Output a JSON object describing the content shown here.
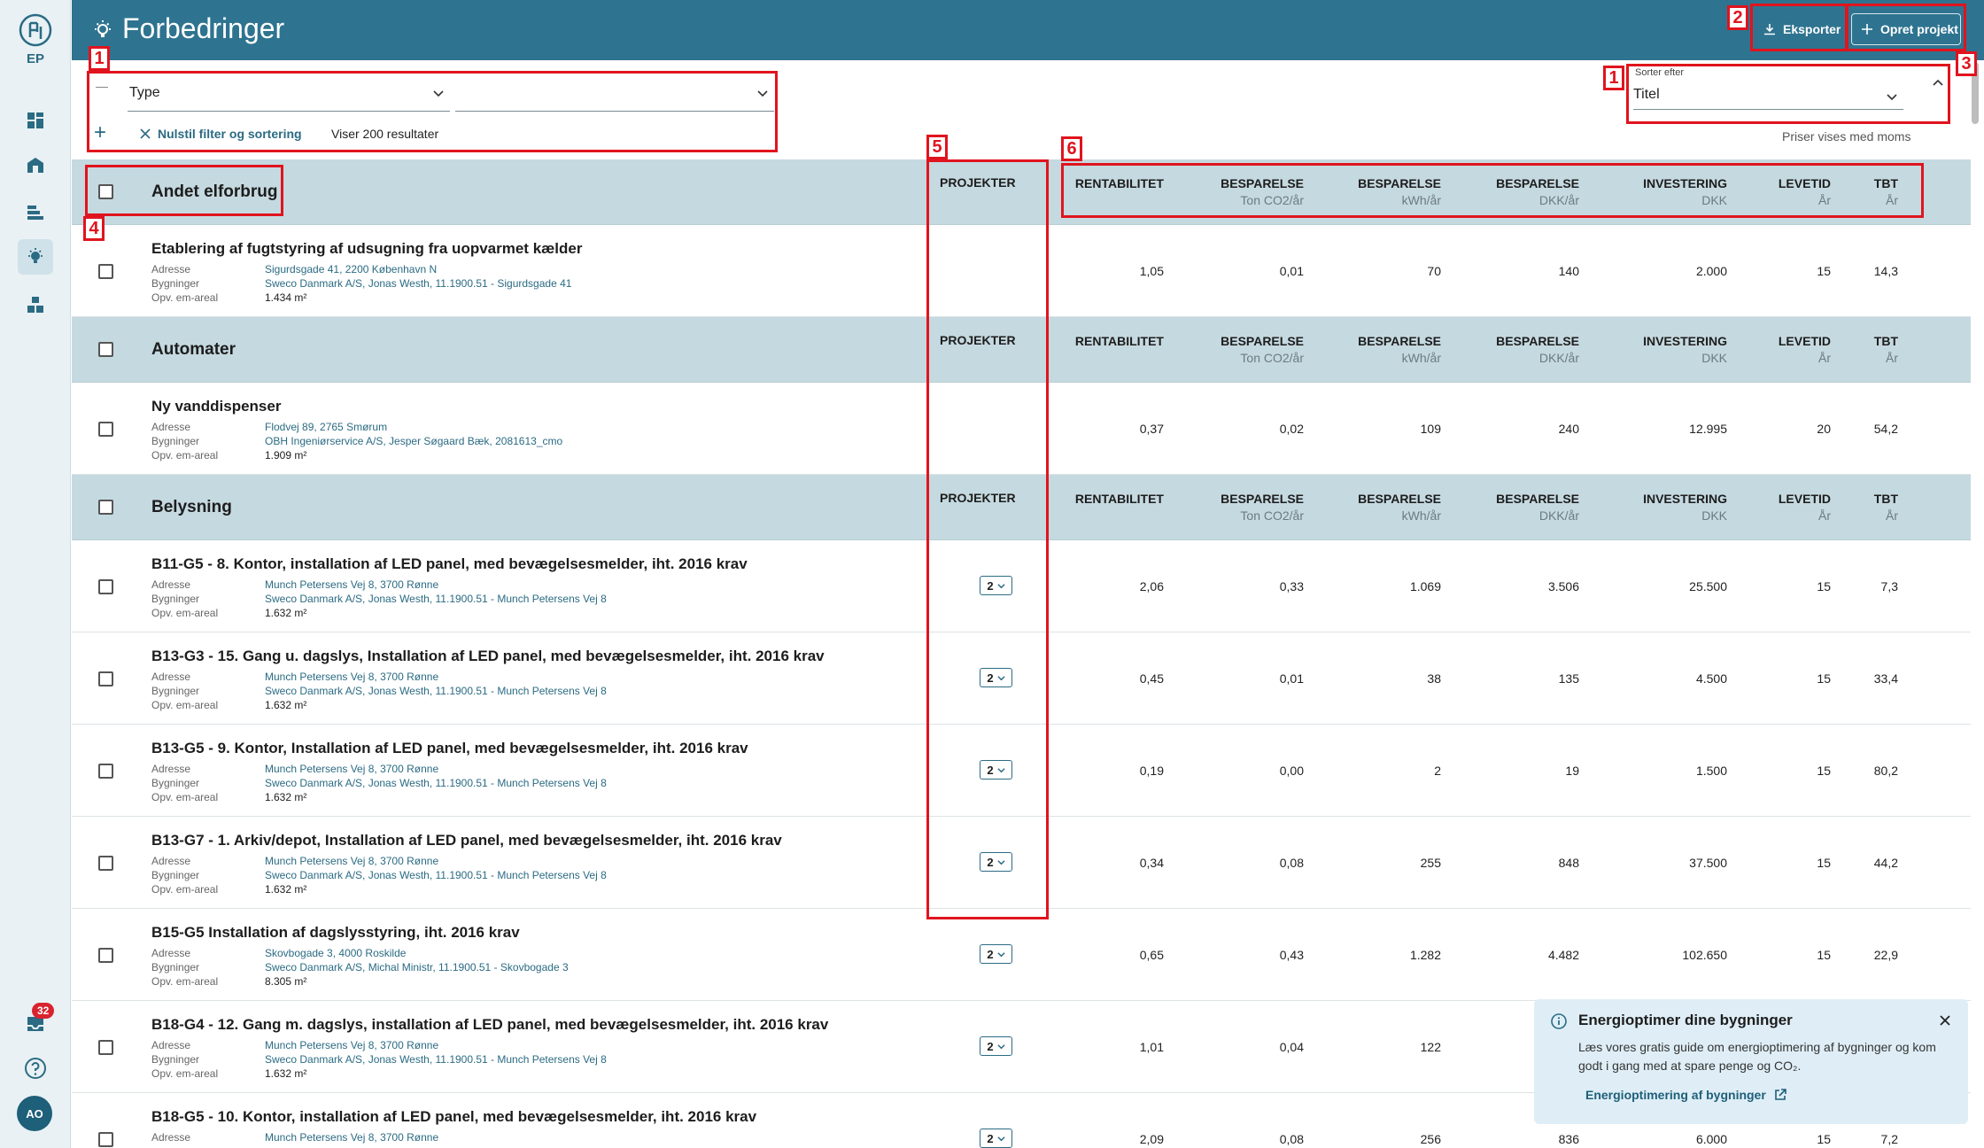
{
  "app": {
    "logo_text": "EP",
    "page_title": "Forbedringer"
  },
  "header": {
    "export_label": "Eksporter",
    "create_label": "Opret projekt"
  },
  "filters": {
    "type_label": "Type",
    "second_value": "",
    "reset_label": "Nulstil filter og sortering",
    "results_text": "Viser 200 resultater"
  },
  "sort": {
    "label": "Sorter efter",
    "value": "Titel"
  },
  "vat_note": "Priser vises med moms",
  "columns": {
    "projects": "PROJEKTER",
    "rentability": "RENTABILITET",
    "saving": "BESPARELSE",
    "co2_unit": "Ton CO2/år",
    "kwh_unit": "kWh/år",
    "dkk_unit": "DKK/år",
    "investment": "INVESTERING",
    "investment_unit": "DKK",
    "lifetime": "LEVETID",
    "lifetime_unit": "År",
    "tbt": "TBT",
    "tbt_unit": "År"
  },
  "labels": {
    "address": "Adresse",
    "buildings": "Bygninger",
    "area": "Opv. em-areal"
  },
  "groups": [
    {
      "title": "Andet elforbrug",
      "rows": [
        {
          "title": "Etablering af fugtstyring af udsugning fra uopvarmet kælder",
          "address": "Sigurdsgade 41, 2200 København N",
          "building": "Sweco Danmark A/S, Jonas Westh, 11.1900.51 - Sigurdsgade 41",
          "area": "1.434 m²",
          "projects": "",
          "rent": "1,05",
          "co2": "0,01",
          "kwh": "70",
          "dkk": "140",
          "inv": "2.000",
          "life": "15",
          "tbt": "14,3"
        }
      ]
    },
    {
      "title": "Automater",
      "rows": [
        {
          "title": "Ny vanddispenser",
          "address": "Flodvej 89, 2765 Smørum",
          "building": "OBH Ingeniørservice A/S, Jesper Søgaard Bæk, 2081613_cmo",
          "area": "1.909 m²",
          "projects": "",
          "rent": "0,37",
          "co2": "0,02",
          "kwh": "109",
          "dkk": "240",
          "inv": "12.995",
          "life": "20",
          "tbt": "54,2"
        }
      ]
    },
    {
      "title": "Belysning",
      "rows": [
        {
          "title": "B11-G5 - 8. Kontor, installation af LED panel, med bevægelsesmelder, iht. 2016 krav",
          "address": "Munch Petersens Vej 8, 3700 Rønne",
          "building": "Sweco Danmark A/S, Jonas Westh, 11.1900.51 - Munch Petersens Vej 8",
          "area": "1.632 m²",
          "projects": "2",
          "rent": "2,06",
          "co2": "0,33",
          "kwh": "1.069",
          "dkk": "3.506",
          "inv": "25.500",
          "life": "15",
          "tbt": "7,3"
        },
        {
          "title": "B13-G3 - 15. Gang u. dagslys, Installation af LED panel, med bevægelsesmelder, iht. 2016 krav",
          "address": "Munch Petersens Vej 8, 3700 Rønne",
          "building": "Sweco Danmark A/S, Jonas Westh, 11.1900.51 - Munch Petersens Vej 8",
          "area": "1.632 m²",
          "projects": "2",
          "rent": "0,45",
          "co2": "0,01",
          "kwh": "38",
          "dkk": "135",
          "inv": "4.500",
          "life": "15",
          "tbt": "33,4"
        },
        {
          "title": "B13-G5 - 9. Kontor, Installation af LED panel, med bevægelsesmelder, iht. 2016 krav",
          "address": "Munch Petersens Vej 8, 3700 Rønne",
          "building": "Sweco Danmark A/S, Jonas Westh, 11.1900.51 - Munch Petersens Vej 8",
          "area": "1.632 m²",
          "projects": "2",
          "rent": "0,19",
          "co2": "0,00",
          "kwh": "2",
          "dkk": "19",
          "inv": "1.500",
          "life": "15",
          "tbt": "80,2"
        },
        {
          "title": "B13-G7 - 1. Arkiv/depot, Installation af LED panel, med bevægelsesmelder, iht. 2016 krav",
          "address": "Munch Petersens Vej 8, 3700 Rønne",
          "building": "Sweco Danmark A/S, Jonas Westh, 11.1900.51 - Munch Petersens Vej 8",
          "area": "1.632 m²",
          "projects": "2",
          "rent": "0,34",
          "co2": "0,08",
          "kwh": "255",
          "dkk": "848",
          "inv": "37.500",
          "life": "15",
          "tbt": "44,2"
        },
        {
          "title": "B15-G5 Installation af dagslysstyring, iht. 2016 krav",
          "address": "Skovbogade 3, 4000 Roskilde",
          "building": "Sweco Danmark A/S, Michal Ministr, 11.1900.51 - Skovbogade 3",
          "area": "8.305 m²",
          "projects": "2",
          "rent": "0,65",
          "co2": "0,43",
          "kwh": "1.282",
          "dkk": "4.482",
          "inv": "102.650",
          "life": "15",
          "tbt": "22,9"
        },
        {
          "title": "B18-G4 - 12. Gang m. dagslys, installation af LED panel, med bevægelsesmelder, iht. 2016 krav",
          "address": "Munch Petersens Vej 8, 3700 Rønne",
          "building": "Sweco Danmark A/S, Jonas Westh, 11.1900.51 - Munch Petersens Vej 8",
          "area": "1.632 m²",
          "projects": "2",
          "rent": "1,01",
          "co2": "0,04",
          "kwh": "122",
          "dkk": "",
          "inv": "",
          "life": "",
          "tbt": ""
        },
        {
          "title": "B18-G5 - 10. Kontor, installation af LED panel, med bevægelsesmelder, iht. 2016 krav",
          "address": "Munch Petersens Vej 8, 3700 Rønne",
          "building": "",
          "area": "",
          "projects": "2",
          "rent": "2,09",
          "co2": "0,08",
          "kwh": "256",
          "dkk": "836",
          "inv": "6.000",
          "life": "15",
          "tbt": "7,2"
        }
      ]
    }
  ],
  "inbox_count": "32",
  "user_initials": "AO",
  "toast": {
    "title": "Energioptimer dine bygninger",
    "body": "Læs vores gratis guide om energioptimering af bygninger og kom godt i gang med at spare penge og CO₂.",
    "link": "Energioptimering af bygninger"
  },
  "annotations": [
    "1",
    "2",
    "3",
    "1",
    "4",
    "5",
    "6"
  ],
  "colors": {
    "brand": "#2e7490",
    "group_bg": "#c5d9e0",
    "link": "#2b6b83",
    "annotation": "#e0141e",
    "toast_bg": "#dfeef6"
  }
}
